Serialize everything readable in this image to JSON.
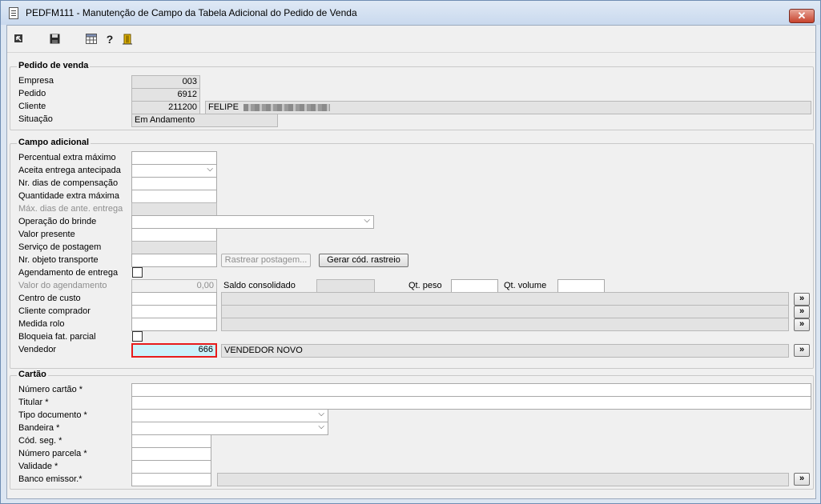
{
  "window": {
    "title": "PEDFM111 - Manutenção de Campo da Tabela Adicional do Pedido de Venda",
    "close_label": "✕"
  },
  "toolbar": {
    "icons": [
      "exit-arrow-icon",
      "save-icon",
      "table-icon",
      "help-icon",
      "door-exit-icon"
    ]
  },
  "pedido": {
    "legend": "Pedido de venda",
    "empresa_label": "Empresa",
    "empresa_value": "003",
    "pedido_label": "Pedido",
    "pedido_value": "6912",
    "cliente_label": "Cliente",
    "cliente_code": "211200",
    "cliente_name": "FELIPE",
    "situacao_label": "Situação",
    "situacao_value": "Em Andamento"
  },
  "campo": {
    "legend": "Campo adicional",
    "percentual_label": "Percentual extra máximo",
    "aceita_label": "Aceita entrega antecipada",
    "dias_comp_label": "Nr. dias de compensação",
    "qtd_extra_label": "Quantidade extra máxima",
    "max_dias_label": "Máx. dias de ante. entrega",
    "operacao_label": "Operação do brinde",
    "valor_presente_label": "Valor presente",
    "servico_label": "Serviço de postagem",
    "nr_objeto_label": "Nr. objeto transporte",
    "rastrear_button": "Rastrear postagem...",
    "gerar_button": "Gerar cód. rastreio",
    "agendamento_label": "Agendamento de entrega",
    "valor_agend_label": "Valor do agendamento",
    "valor_agend_value": "0,00",
    "saldo_label": "Saldo consolidado",
    "qt_peso_label": "Qt. peso",
    "qt_volume_label": "Qt. volume",
    "centro_label": "Centro de custo",
    "cliente_comprador_label": "Cliente comprador",
    "medida_label": "Medida rolo",
    "bloqueia_label": "Bloqueia fat. parcial",
    "vendedor_label": "Vendedor",
    "vendedor_code": "666",
    "vendedor_name": "VENDEDOR NOVO",
    "lookup_label": "»"
  },
  "cartao": {
    "legend": "Cartão",
    "numero_label": "Número cartão *",
    "titular_label": "Titular *",
    "tipo_doc_label": "Tipo documento *",
    "bandeira_label": "Bandeira *",
    "cod_seg_label": "Cód. seg. *",
    "parcela_label": "Número parcela *",
    "validade_label": "Validade *",
    "banco_label": "Banco emissor.*"
  }
}
